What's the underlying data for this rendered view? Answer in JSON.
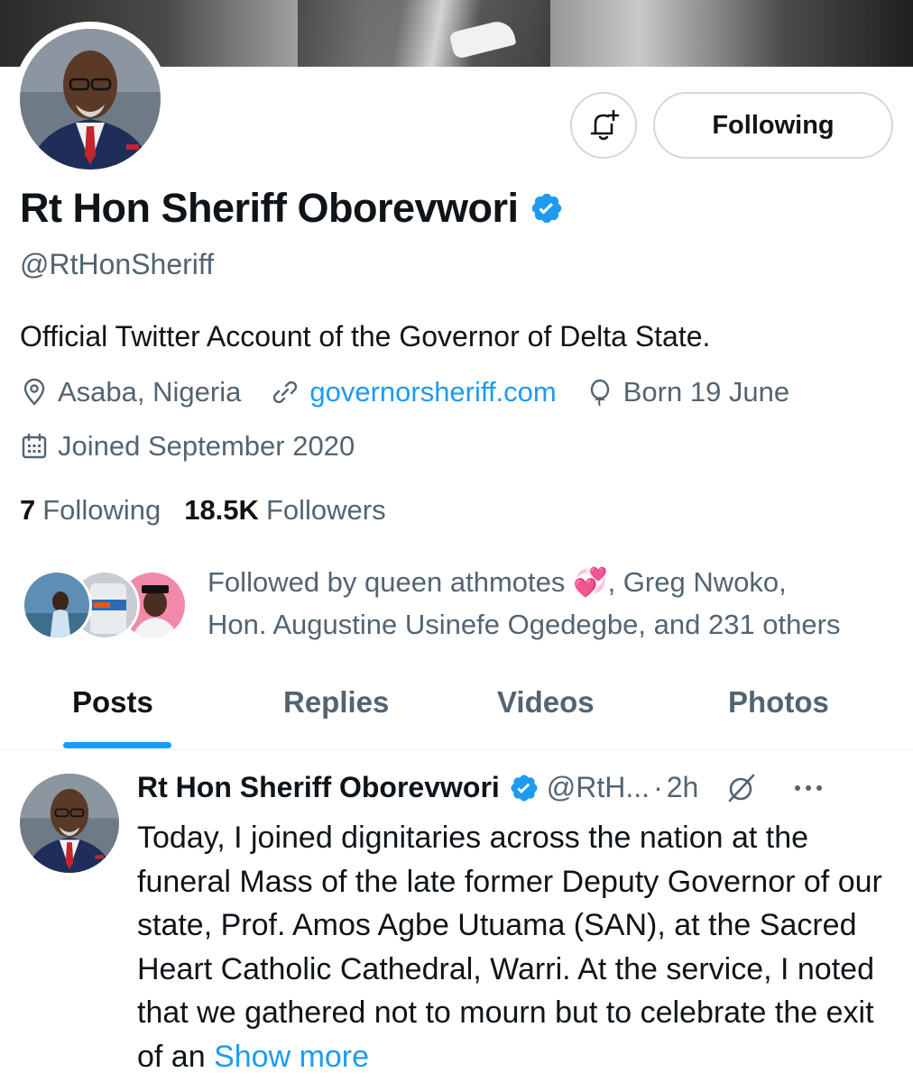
{
  "profile": {
    "display_name": "Rt Hon Sheriff Oborevwori",
    "handle": "@RtHonSheriff",
    "bio": "Official Twitter Account of the Governor of Delta State.",
    "location": "Asaba, Nigeria",
    "website": "governorsheriff.com",
    "birthday": "Born 19 June",
    "joined": "Joined September 2020",
    "following_count": "7",
    "following_label": "Following",
    "followers_count": "18.5K",
    "followers_label": "Followers"
  },
  "actions": {
    "follow_button_label": "Following",
    "notify_icon": "bell-plus-icon"
  },
  "followed_by": {
    "prefix": "Followed by queen athmotes ",
    "emoji": "💞",
    "line1_rest": ", Greg Nwoko,",
    "line2": "Hon. Augustine Usinefe Ogedegbe, and 231 others"
  },
  "tabs": [
    {
      "label": "Posts",
      "active": true
    },
    {
      "label": "Replies",
      "active": false
    },
    {
      "label": "Videos",
      "active": false
    },
    {
      "label": "Photos",
      "active": false
    }
  ],
  "post": {
    "author": "Rt Hon Sheriff Oborevwori",
    "handle": "@RtH...",
    "separator": "·",
    "time": "2h",
    "text": "Today, I joined dignitaries across the nation at the funeral Mass of the late former Deputy Governor of our state, Prof. Amos Agbe Utuama (SAN), at the Sacred Heart Catholic Cathedral, Warri. At the service, I noted that we gathered not to mourn but to celebrate the exit of an ",
    "show_more": "Show more"
  },
  "colors": {
    "accent": "#1d9bf0",
    "text_primary": "#0f1419",
    "text_secondary": "#536471",
    "border": "#cfd9de"
  }
}
